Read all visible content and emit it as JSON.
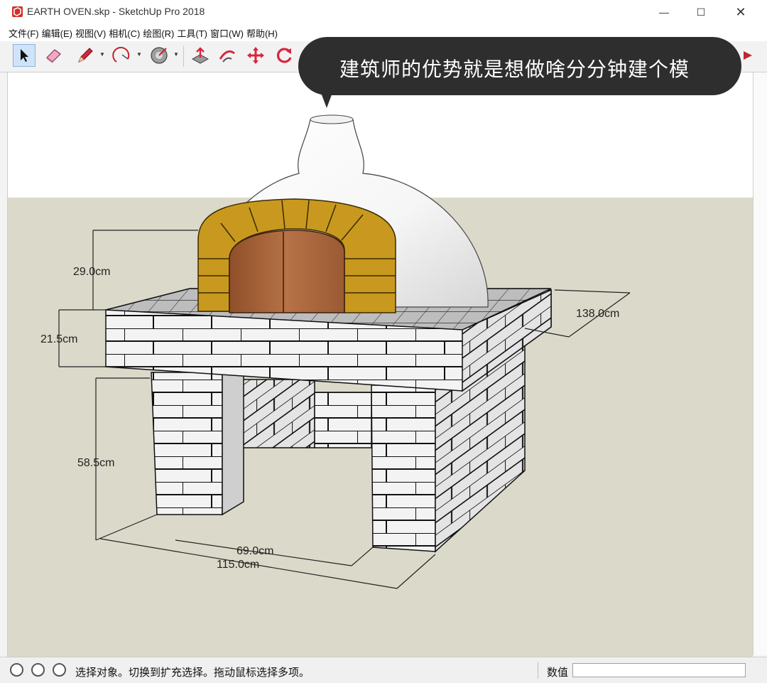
{
  "window": {
    "title": "EARTH OVEN.skp - SketchUp Pro 2018",
    "minimize_glyph": "—",
    "maximize_glyph": "☐",
    "close_glyph": "✕"
  },
  "menu": [
    "文件(F)",
    "编辑(E)",
    "视图(V)",
    "相机(C)",
    "绘图(R)",
    "工具(T)",
    "窗口(W)",
    "帮助(H)"
  ],
  "toolbar": {
    "tools": [
      "select-icon",
      "eraser-icon",
      "pencil-icon",
      "arc-icon",
      "paint-bucket-icon",
      "push-pull-icon",
      "follow-me-icon",
      "move-icon",
      "rotate-icon",
      "scale-icon"
    ]
  },
  "overlay": {
    "caption": "建筑师的优势就是想做啥分分钟建个模"
  },
  "model": {
    "dimensions": {
      "dome_height": "29.0cm",
      "top_thickness": "21.5cm",
      "base_height": "58.5cm",
      "depth": "138.0cm",
      "inner_width": "69.0cm",
      "total_width": "115.0cm"
    }
  },
  "statusbar": {
    "hint": "选择对象。切换到扩充选择。拖动鼠标选择多项。",
    "measure_label": "数值",
    "measure_value": ""
  },
  "colors": {
    "ground": "#dbd9c9",
    "brick_face": "#f4f4f4",
    "arch_brick": "#c59a22",
    "door_wood": "#a8643a",
    "bubble": "#2e2e2e"
  }
}
